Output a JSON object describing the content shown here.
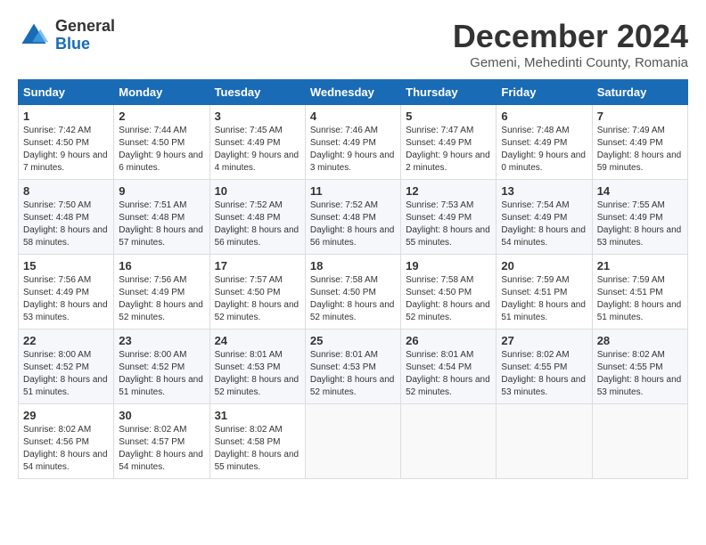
{
  "logo": {
    "general": "General",
    "blue": "Blue"
  },
  "header": {
    "month": "December 2024",
    "location": "Gemeni, Mehedinti County, Romania"
  },
  "weekdays": [
    "Sunday",
    "Monday",
    "Tuesday",
    "Wednesday",
    "Thursday",
    "Friday",
    "Saturday"
  ],
  "weeks": [
    [
      {
        "day": "1",
        "sunrise": "7:42 AM",
        "sunset": "4:50 PM",
        "daylight": "9 hours and 7 minutes."
      },
      {
        "day": "2",
        "sunrise": "7:44 AM",
        "sunset": "4:50 PM",
        "daylight": "9 hours and 6 minutes."
      },
      {
        "day": "3",
        "sunrise": "7:45 AM",
        "sunset": "4:49 PM",
        "daylight": "9 hours and 4 minutes."
      },
      {
        "day": "4",
        "sunrise": "7:46 AM",
        "sunset": "4:49 PM",
        "daylight": "9 hours and 3 minutes."
      },
      {
        "day": "5",
        "sunrise": "7:47 AM",
        "sunset": "4:49 PM",
        "daylight": "9 hours and 2 minutes."
      },
      {
        "day": "6",
        "sunrise": "7:48 AM",
        "sunset": "4:49 PM",
        "daylight": "9 hours and 0 minutes."
      },
      {
        "day": "7",
        "sunrise": "7:49 AM",
        "sunset": "4:49 PM",
        "daylight": "8 hours and 59 minutes."
      }
    ],
    [
      {
        "day": "8",
        "sunrise": "7:50 AM",
        "sunset": "4:48 PM",
        "daylight": "8 hours and 58 minutes."
      },
      {
        "day": "9",
        "sunrise": "7:51 AM",
        "sunset": "4:48 PM",
        "daylight": "8 hours and 57 minutes."
      },
      {
        "day": "10",
        "sunrise": "7:52 AM",
        "sunset": "4:48 PM",
        "daylight": "8 hours and 56 minutes."
      },
      {
        "day": "11",
        "sunrise": "7:52 AM",
        "sunset": "4:48 PM",
        "daylight": "8 hours and 56 minutes."
      },
      {
        "day": "12",
        "sunrise": "7:53 AM",
        "sunset": "4:49 PM",
        "daylight": "8 hours and 55 minutes."
      },
      {
        "day": "13",
        "sunrise": "7:54 AM",
        "sunset": "4:49 PM",
        "daylight": "8 hours and 54 minutes."
      },
      {
        "day": "14",
        "sunrise": "7:55 AM",
        "sunset": "4:49 PM",
        "daylight": "8 hours and 53 minutes."
      }
    ],
    [
      {
        "day": "15",
        "sunrise": "7:56 AM",
        "sunset": "4:49 PM",
        "daylight": "8 hours and 53 minutes."
      },
      {
        "day": "16",
        "sunrise": "7:56 AM",
        "sunset": "4:49 PM",
        "daylight": "8 hours and 52 minutes."
      },
      {
        "day": "17",
        "sunrise": "7:57 AM",
        "sunset": "4:50 PM",
        "daylight": "8 hours and 52 minutes."
      },
      {
        "day": "18",
        "sunrise": "7:58 AM",
        "sunset": "4:50 PM",
        "daylight": "8 hours and 52 minutes."
      },
      {
        "day": "19",
        "sunrise": "7:58 AM",
        "sunset": "4:50 PM",
        "daylight": "8 hours and 52 minutes."
      },
      {
        "day": "20",
        "sunrise": "7:59 AM",
        "sunset": "4:51 PM",
        "daylight": "8 hours and 51 minutes."
      },
      {
        "day": "21",
        "sunrise": "7:59 AM",
        "sunset": "4:51 PM",
        "daylight": "8 hours and 51 minutes."
      }
    ],
    [
      {
        "day": "22",
        "sunrise": "8:00 AM",
        "sunset": "4:52 PM",
        "daylight": "8 hours and 51 minutes."
      },
      {
        "day": "23",
        "sunrise": "8:00 AM",
        "sunset": "4:52 PM",
        "daylight": "8 hours and 51 minutes."
      },
      {
        "day": "24",
        "sunrise": "8:01 AM",
        "sunset": "4:53 PM",
        "daylight": "8 hours and 52 minutes."
      },
      {
        "day": "25",
        "sunrise": "8:01 AM",
        "sunset": "4:53 PM",
        "daylight": "8 hours and 52 minutes."
      },
      {
        "day": "26",
        "sunrise": "8:01 AM",
        "sunset": "4:54 PM",
        "daylight": "8 hours and 52 minutes."
      },
      {
        "day": "27",
        "sunrise": "8:02 AM",
        "sunset": "4:55 PM",
        "daylight": "8 hours and 53 minutes."
      },
      {
        "day": "28",
        "sunrise": "8:02 AM",
        "sunset": "4:55 PM",
        "daylight": "8 hours and 53 minutes."
      }
    ],
    [
      {
        "day": "29",
        "sunrise": "8:02 AM",
        "sunset": "4:56 PM",
        "daylight": "8 hours and 54 minutes."
      },
      {
        "day": "30",
        "sunrise": "8:02 AM",
        "sunset": "4:57 PM",
        "daylight": "8 hours and 54 minutes."
      },
      {
        "day": "31",
        "sunrise": "8:02 AM",
        "sunset": "4:58 PM",
        "daylight": "8 hours and 55 minutes."
      },
      null,
      null,
      null,
      null
    ]
  ],
  "labels": {
    "sunrise": "Sunrise:",
    "sunset": "Sunset:",
    "daylight": "Daylight:"
  }
}
